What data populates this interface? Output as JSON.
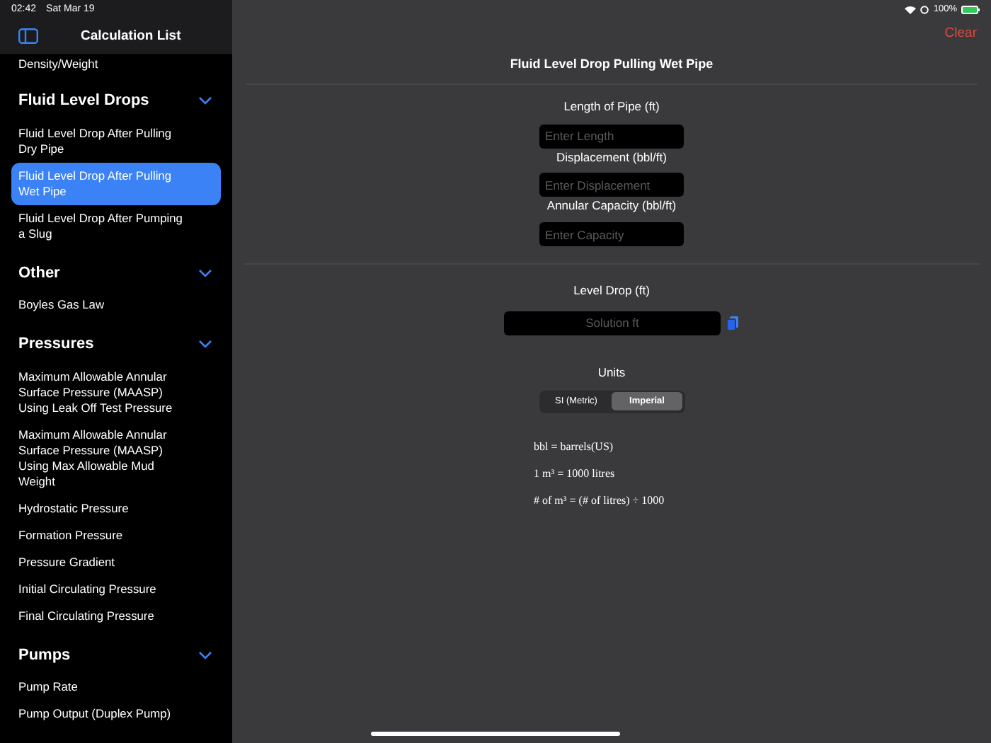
{
  "status_bar": {
    "time": "02:42",
    "date": "Sat Mar 19",
    "battery": "100%"
  },
  "sidebar": {
    "title": "Calculation List",
    "top_items": [
      {
        "label": "Density/Weight",
        "selected": false
      }
    ],
    "sections": [
      {
        "title": "Fluid Level Drops",
        "expanded": true,
        "items": [
          {
            "label": "Fluid Level Drop After Pulling Dry Pipe",
            "selected": false
          },
          {
            "label": "Fluid Level Drop After Pulling Wet Pipe",
            "selected": true
          },
          {
            "label": "Fluid Level Drop After Pumping a Slug",
            "selected": false
          }
        ]
      },
      {
        "title": "Other",
        "expanded": true,
        "items": [
          {
            "label": "Boyles Gas Law",
            "selected": false
          }
        ]
      },
      {
        "title": "Pressures",
        "expanded": true,
        "items": [
          {
            "label": "Maximum Allowable Annular Surface Pressure (MAASP) Using Leak Off Test Pressure",
            "selected": false
          },
          {
            "label": "Maximum Allowable Annular Surface Pressure (MAASP) Using Max Allowable Mud Weight",
            "selected": false
          },
          {
            "label": "Hydrostatic Pressure",
            "selected": false
          },
          {
            "label": "Formation Pressure",
            "selected": false
          },
          {
            "label": "Pressure Gradient",
            "selected": false
          },
          {
            "label": "Initial Circulating Pressure",
            "selected": false
          },
          {
            "label": "Final Circulating Pressure",
            "selected": false
          }
        ]
      },
      {
        "title": "Pumps",
        "expanded": true,
        "items": [
          {
            "label": "Pump Rate",
            "selected": false
          },
          {
            "label": "Pump Output (Duplex Pump)",
            "selected": false
          }
        ]
      }
    ]
  },
  "main": {
    "clear_button": "Clear",
    "title": "Fluid Level Drop Pulling Wet Pipe",
    "inputs": [
      {
        "label": "Length of Pipe (ft)",
        "placeholder": "Enter Length"
      },
      {
        "label": "Displacement (bbl/ft)",
        "placeholder": "Enter Displacement"
      },
      {
        "label": "Annular Capacity (bbl/ft)",
        "placeholder": "Enter Capacity"
      }
    ],
    "result": {
      "label": "Level Drop (ft)",
      "placeholder": "Solution ft"
    },
    "units": {
      "label": "Units",
      "options": [
        {
          "label": "SI (Metric)",
          "selected": false
        },
        {
          "label": "Imperial",
          "selected": true
        }
      ]
    },
    "notes": [
      "bbl = barrels(US)",
      "1 m³ = 1000 litres",
      "# of m³ = (# of litres) ÷ 1000"
    ]
  }
}
